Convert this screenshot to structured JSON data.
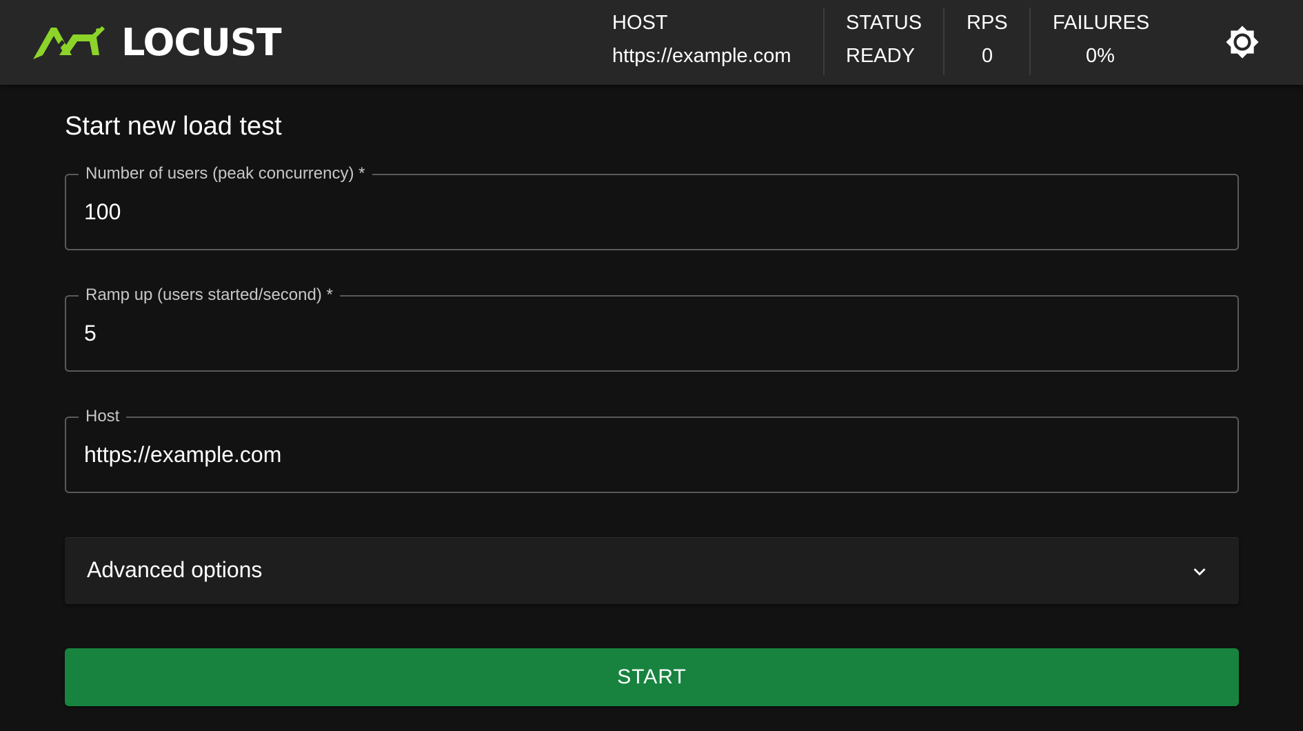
{
  "header": {
    "logo_text": "LOCUST",
    "brand_color": "#8cd42a",
    "stats": {
      "host": {
        "label": "HOST",
        "value": "https://example.com"
      },
      "status": {
        "label": "STATUS",
        "value": "READY"
      },
      "rps": {
        "label": "RPS",
        "value": "0"
      },
      "failures": {
        "label": "FAILURES",
        "value": "0%"
      }
    },
    "theme_icon": "sun-icon"
  },
  "form": {
    "title": "Start new load test",
    "users": {
      "label": "Number of users (peak concurrency) *",
      "value": "100"
    },
    "ramp_up": {
      "label": "Ramp up (users started/second) *",
      "value": "5"
    },
    "host": {
      "label": "Host",
      "value": "https://example.com"
    },
    "advanced": {
      "label": "Advanced options",
      "icon": "chevron-down-icon"
    },
    "start_label": "START",
    "start_color": "#17833f"
  }
}
